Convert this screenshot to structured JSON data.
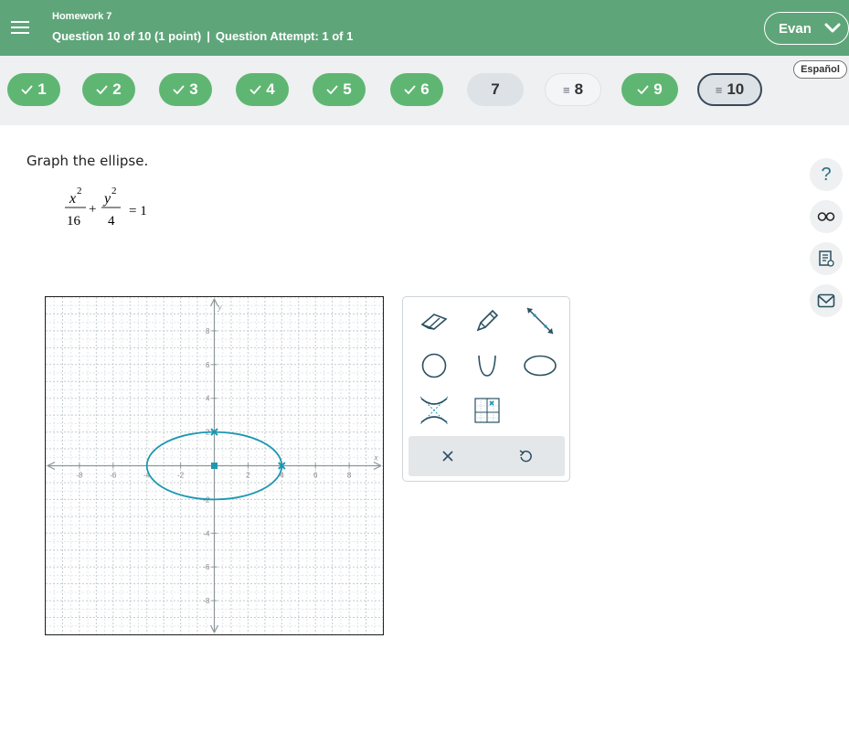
{
  "header": {
    "assignment_title": "Homework 7",
    "question_position": "Question 10 of 10 (1 point)",
    "separator": "|",
    "attempt": "Question Attempt: 1 of 1",
    "user_name": "Evan",
    "brand_color": "#5fa57a"
  },
  "question_nav": [
    {
      "label": "1",
      "status": "correct"
    },
    {
      "label": "2",
      "status": "correct"
    },
    {
      "label": "3",
      "status": "correct"
    },
    {
      "label": "4",
      "status": "correct"
    },
    {
      "label": "5",
      "status": "correct"
    },
    {
      "label": "6",
      "status": "correct"
    },
    {
      "label": "7",
      "status": "unanswered"
    },
    {
      "label": "8",
      "status": "partial"
    },
    {
      "label": "9",
      "status": "correct"
    },
    {
      "label": "10",
      "status": "current"
    }
  ],
  "language_button": "Español",
  "side_tools": [
    "help-icon",
    "glasses-icon",
    "notes-icon",
    "mail-icon"
  ],
  "question": {
    "prompt": "Graph the ellipse.",
    "equation": {
      "term1_num": "x",
      "term1_exp": "2",
      "term1_den": "16",
      "plus": "+",
      "term2_num": "y",
      "term2_exp": "2",
      "term2_den": "4",
      "rhs": "= 1"
    }
  },
  "graph": {
    "x_axis_label": "x",
    "y_axis_label": "y",
    "x_range": [
      -10,
      10
    ],
    "y_range": [
      -10,
      10
    ],
    "x_tick_labels": [
      "-8",
      "-6",
      "-4",
      "-2",
      "2",
      "4",
      "6",
      "8"
    ],
    "y_tick_labels": [
      "8",
      "6",
      "4",
      "2",
      "-2",
      "-4",
      "-6",
      "-8"
    ],
    "ellipse": {
      "center": [
        0,
        0
      ],
      "semi_major_x": 4,
      "semi_minor_y": 2
    },
    "vertex_marks": [
      [
        4,
        0
      ],
      [
        0,
        2
      ]
    ],
    "center_mark": [
      0,
      0
    ],
    "curve_color": "#1c98b2",
    "grid": true
  },
  "palette": {
    "tools": [
      "eraser-icon",
      "pencil-icon",
      "line-segment-icon",
      "circle-icon",
      "parabola-icon",
      "ellipse-icon",
      "hyperbola-icon",
      "point-plot-icon"
    ],
    "actions": [
      "clear-icon",
      "undo-icon"
    ]
  }
}
